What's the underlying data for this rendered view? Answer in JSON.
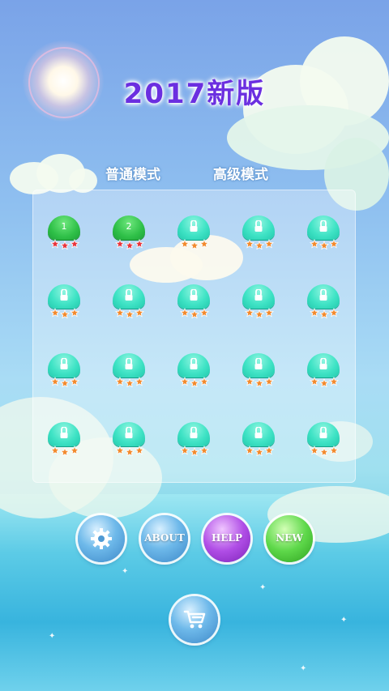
{
  "title": "2017新版",
  "tabs": [
    {
      "label": "普通模式",
      "active": true
    },
    {
      "label": "高级模式",
      "active": false
    }
  ],
  "levels": [
    {
      "number": "1",
      "unlocked": true
    },
    {
      "number": "2",
      "unlocked": true
    },
    {
      "number": "",
      "unlocked": false
    },
    {
      "number": "",
      "unlocked": false
    },
    {
      "number": "",
      "unlocked": false
    },
    {
      "number": "",
      "unlocked": false
    },
    {
      "number": "",
      "unlocked": false
    },
    {
      "number": "",
      "unlocked": false
    },
    {
      "number": "",
      "unlocked": false
    },
    {
      "number": "",
      "unlocked": false
    },
    {
      "number": "",
      "unlocked": false
    },
    {
      "number": "",
      "unlocked": false
    },
    {
      "number": "",
      "unlocked": false
    },
    {
      "number": "",
      "unlocked": false
    },
    {
      "number": "",
      "unlocked": false
    },
    {
      "number": "",
      "unlocked": false
    },
    {
      "number": "",
      "unlocked": false
    },
    {
      "number": "",
      "unlocked": false
    },
    {
      "number": "",
      "unlocked": false
    },
    {
      "number": "",
      "unlocked": false
    }
  ],
  "buttons": {
    "settings_icon": "gear-icon",
    "about_label": "ABOUT",
    "help_label": "HELP",
    "new_label": "NEW",
    "shop_icon": "cart-icon"
  },
  "colors": {
    "title": "#6b2fe0",
    "unlocked_level": "#2fc048",
    "locked_level": "#3fe3c5",
    "star_red": "#e8343c",
    "star_orange": "#f28a2e",
    "help_button": "#b04ee6",
    "new_button": "#5ed84a"
  }
}
